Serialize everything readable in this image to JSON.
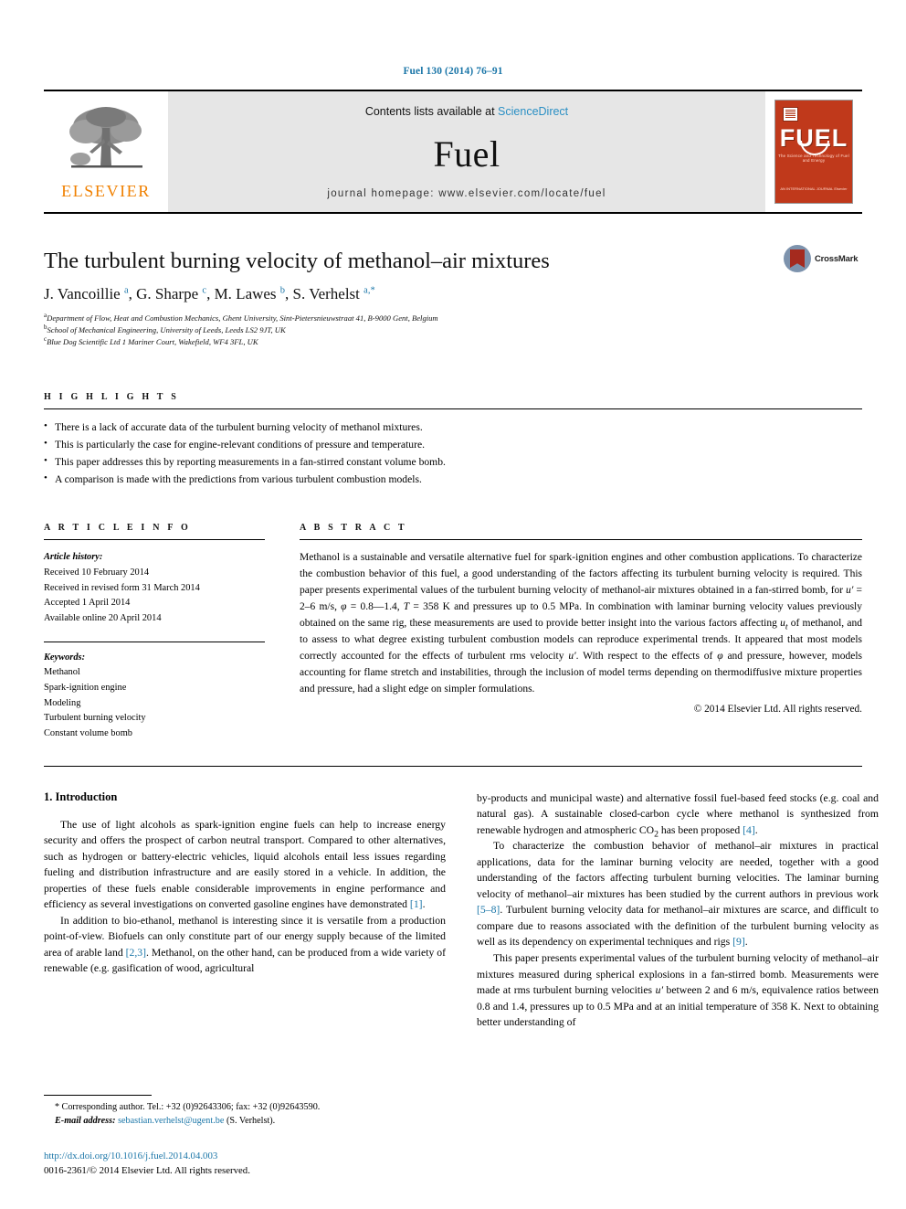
{
  "journal_ref": "Fuel 130 (2014) 76–91",
  "masthead": {
    "publisher_name": "ELSEVIER",
    "contents_prefix": "Contents lists available at ",
    "contents_link": "ScienceDirect",
    "journal_title": "Fuel",
    "homepage_line": "journal homepage: www.elsevier.com/locate/fuel",
    "cover": {
      "title": "FUEL",
      "subtitle": "The Science and Technology of Fuel and Energy",
      "footer": "AN INTERNATIONAL JOURNAL\nElsevier"
    }
  },
  "article": {
    "title": "The turbulent burning velocity of methanol–air mixtures",
    "authors_html": "J. Vancoillie <sup>a</sup>, G. Sharpe <sup>c</sup>, M. Lawes <sup>b</sup>, S. Verhelst <sup>a,*</sup>",
    "affiliations": [
      "Department of Flow, Heat and Combustion Mechanics, Ghent University, Sint-Pietersnieuwstraat 41, B-9000 Gent, Belgium",
      "School of Mechanical Engineering, University of Leeds, Leeds LS2 9JT, UK",
      "Blue Dog Scientific Ltd 1 Mariner Court, Wakefield, WF4 3FL, UK"
    ],
    "affiliation_markers": [
      "a",
      "b",
      "c"
    ],
    "crossmark_label": "CrossMark"
  },
  "highlights": {
    "heading": "H I G H L I G H T S",
    "items": [
      "There is a lack of accurate data of the turbulent burning velocity of methanol mixtures.",
      "This is particularly the case for engine-relevant conditions of pressure and temperature.",
      "This paper addresses this by reporting measurements in a fan-stirred constant volume bomb.",
      "A comparison is made with the predictions from various turbulent combustion models."
    ]
  },
  "article_info": {
    "heading": "A R T I C L E   I N F O",
    "history_label": "Article history:",
    "history": [
      "Received 10 February 2014",
      "Received in revised form 31 March 2014",
      "Accepted 1 April 2014",
      "Available online 20 April 2014"
    ],
    "keywords_label": "Keywords:",
    "keywords": [
      "Methanol",
      "Spark-ignition engine",
      "Modeling",
      "Turbulent burning velocity",
      "Constant volume bomb"
    ]
  },
  "abstract": {
    "heading": "A B S T R A C T",
    "text_html": "Methanol is a sustainable and versatile alternative fuel for spark-ignition engines and other combustion applications. To characterize the combustion behavior of this fuel, a good understanding of the factors affecting its turbulent burning velocity is required. This paper presents experimental values of the turbulent burning velocity of methanol-air mixtures obtained in a fan-stirred bomb, for <i>u&prime;</i> = 2–6 m/s, <i>&phi;</i> = 0.8—1.4, <i>T</i> = 358 K and pressures up to 0.5 MPa. In combination with laminar burning velocity values previously obtained on the same rig, these measurements are used to provide better insight into the various factors affecting <i>u<sub>t</sub></i> of methanol, and to assess to what degree existing turbulent combustion models can reproduce experimental trends. It appeared that most models correctly accounted for the effects of turbulent rms velocity <i>u&prime;</i>. With respect to the effects of <i>&phi;</i> and pressure, however, models accounting for flame stretch and instabilities, through the inclusion of model terms depending on thermodiffusive mixture properties and pressure, had a slight edge on simpler formulations.",
    "copyright": "© 2014 Elsevier Ltd. All rights reserved."
  },
  "body": {
    "section_number_title": "1. Introduction",
    "left_paragraphs_html": [
      "The use of light alcohols as spark-ignition engine fuels can help to increase energy security and offers the prospect of carbon neutral transport. Compared to other alternatives, such as hydrogen or battery-electric vehicles, liquid alcohols entail less issues regarding fueling and distribution infrastructure and are easily stored in a vehicle. In addition, the properties of these fuels enable considerable improvements in engine performance and efficiency as several investigations on converted gasoline engines have demonstrated <span class=\"ref\">[1]</span>.",
      "In addition to bio-ethanol, methanol is interesting since it is versatile from a production point-of-view. Biofuels can only constitute part of our energy supply because of the limited area of arable land <span class=\"ref\">[2,3]</span>. Methanol, on the other hand, can be produced from a wide variety of renewable (e.g. gasification of wood, agricultural"
    ],
    "right_paragraphs_html": [
      "by-products and municipal waste) and alternative fossil fuel-based feed stocks (e.g. coal and natural gas). A sustainable closed-carbon cycle where methanol is synthesized from renewable hydrogen and atmospheric CO<sub>2</sub> has been proposed <span class=\"ref\">[4]</span>.",
      "To characterize the combustion behavior of methanol–air mixtures in practical applications, data for the laminar burning velocity are needed, together with a good understanding of the factors affecting turbulent burning velocities. The laminar burning velocity of methanol–air mixtures has been studied by the current authors in previous work <span class=\"ref\">[5–8]</span>. Turbulent burning velocity data for methanol–air mixtures are scarce, and difficult to compare due to reasons associated with the definition of the turbulent burning velocity as well as its dependency on experimental techniques and rigs <span class=\"ref\">[9]</span>.",
      "This paper presents experimental values of the turbulent burning velocity of methanol–air mixtures measured during spherical explosions in a fan-stirred bomb. Measurements were made at rms turbulent burning velocities <i>u&prime;</i> between 2 and 6 m/s, equivalence ratios between 0.8 and 1.4, pressures up to 0.5 MPa and at an initial temperature of 358 K. Next to obtaining better understanding of"
    ]
  },
  "footnote": {
    "corresponding_html": "<span class=\"star\">*</span> Corresponding author. Tel.: +32 (0)92643306; fax: +32 (0)92643590.",
    "email_label": "E-mail address:",
    "email": "sebastian.verhelst@ugent.be",
    "email_suffix": "(S. Verhelst).",
    "doi": "http://dx.doi.org/10.1016/j.fuel.2014.04.003",
    "issn_line": "0016-2361/© 2014 Elsevier Ltd. All rights reserved."
  },
  "colors": {
    "link_blue": "#1b76a8",
    "elsevier_orange": "#f08000",
    "cover_red": "#c0391b",
    "masthead_grey": "#e6e6e6"
  }
}
